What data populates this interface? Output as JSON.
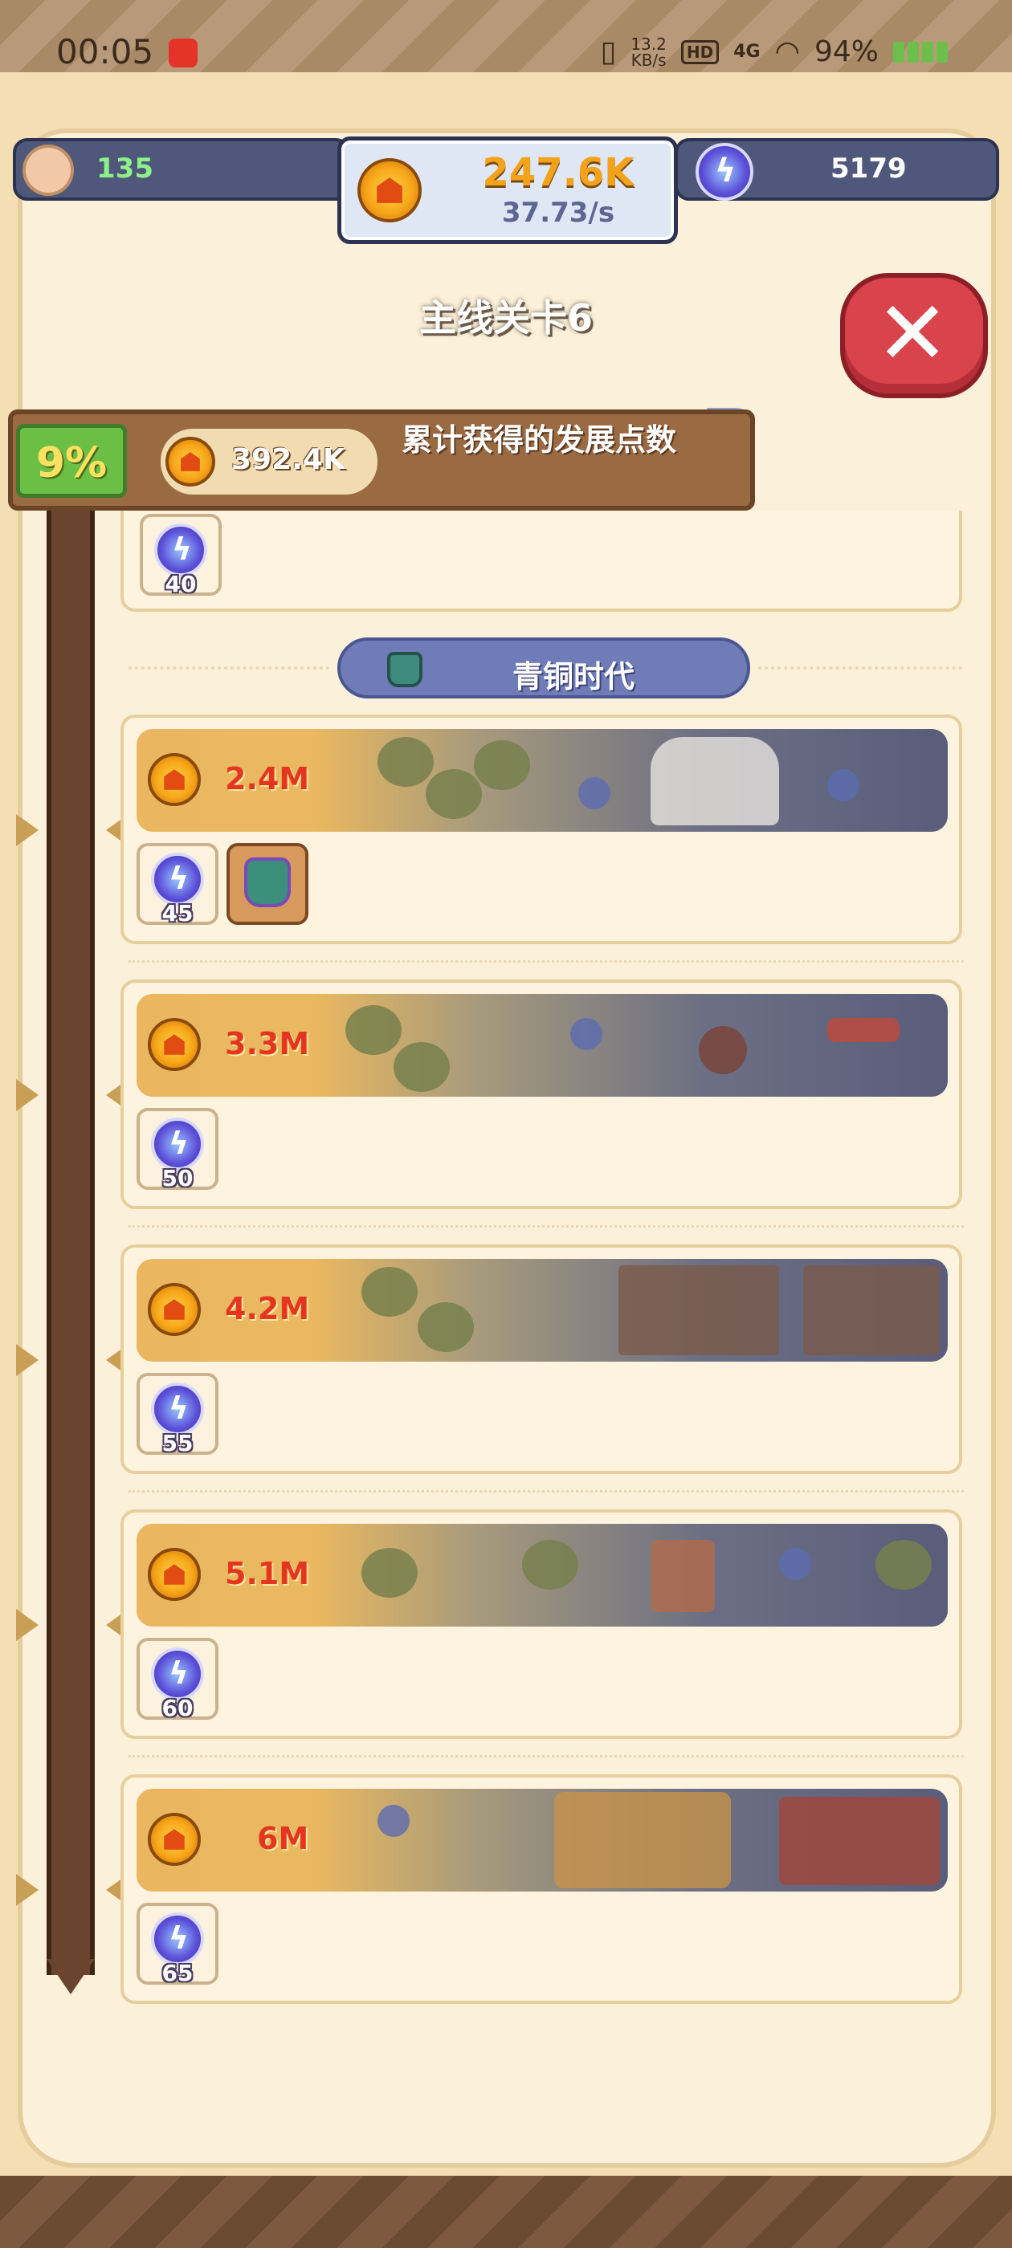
{
  "status_bar": {
    "time": "00:05",
    "net_speed": "13.2",
    "net_unit": "KB/s",
    "hd": "HD",
    "signal": "4G",
    "battery": "94%"
  },
  "resources": {
    "population": "135",
    "coins": "247.6K",
    "coin_rate": "37.73/s",
    "gems": "5179"
  },
  "header": {
    "title": "主线关卡6"
  },
  "progress": {
    "percent_label": "9%",
    "points": "392.4K",
    "label": "累计获得的发展点数"
  },
  "age": {
    "name": "青铜时代"
  },
  "levels": [
    {
      "gems": "40"
    },
    {
      "requirement": "2.4M",
      "gems": "45",
      "has_relic": true
    },
    {
      "requirement": "3.3M",
      "gems": "50"
    },
    {
      "requirement": "4.2M",
      "gems": "55"
    },
    {
      "requirement": "5.1M",
      "gems": "60"
    },
    {
      "requirement": "6M",
      "gems": "65"
    }
  ],
  "colors": {
    "accent_red": "#e4361f",
    "coin_gold": "#f3a21c",
    "panel_bg": "#fbf0d9",
    "progress_green": "#6cbf45"
  }
}
